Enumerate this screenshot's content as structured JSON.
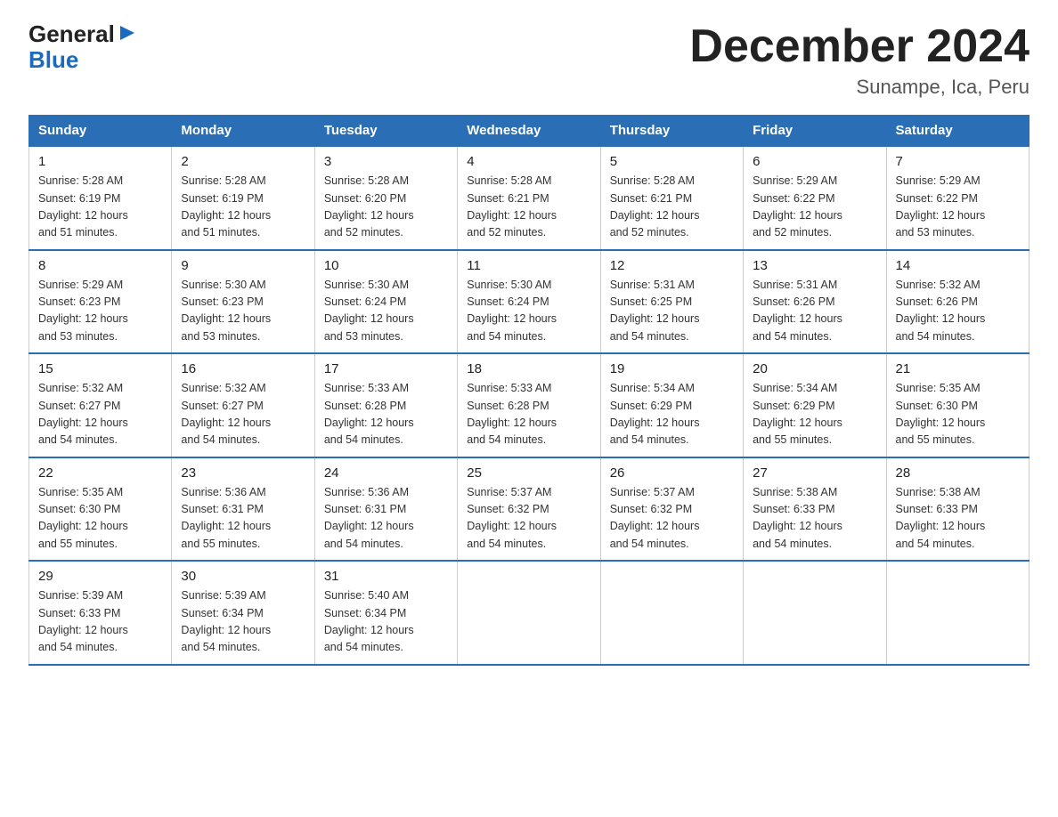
{
  "logo": {
    "general": "General",
    "blue": "Blue"
  },
  "title": "December 2024",
  "location": "Sunampe, Ica, Peru",
  "days_of_week": [
    "Sunday",
    "Monday",
    "Tuesday",
    "Wednesday",
    "Thursday",
    "Friday",
    "Saturday"
  ],
  "weeks": [
    [
      {
        "day": "1",
        "sunrise": "5:28 AM",
        "sunset": "6:19 PM",
        "daylight": "12 hours and 51 minutes."
      },
      {
        "day": "2",
        "sunrise": "5:28 AM",
        "sunset": "6:19 PM",
        "daylight": "12 hours and 51 minutes."
      },
      {
        "day": "3",
        "sunrise": "5:28 AM",
        "sunset": "6:20 PM",
        "daylight": "12 hours and 52 minutes."
      },
      {
        "day": "4",
        "sunrise": "5:28 AM",
        "sunset": "6:21 PM",
        "daylight": "12 hours and 52 minutes."
      },
      {
        "day": "5",
        "sunrise": "5:28 AM",
        "sunset": "6:21 PM",
        "daylight": "12 hours and 52 minutes."
      },
      {
        "day": "6",
        "sunrise": "5:29 AM",
        "sunset": "6:22 PM",
        "daylight": "12 hours and 52 minutes."
      },
      {
        "day": "7",
        "sunrise": "5:29 AM",
        "sunset": "6:22 PM",
        "daylight": "12 hours and 53 minutes."
      }
    ],
    [
      {
        "day": "8",
        "sunrise": "5:29 AM",
        "sunset": "6:23 PM",
        "daylight": "12 hours and 53 minutes."
      },
      {
        "day": "9",
        "sunrise": "5:30 AM",
        "sunset": "6:23 PM",
        "daylight": "12 hours and 53 minutes."
      },
      {
        "day": "10",
        "sunrise": "5:30 AM",
        "sunset": "6:24 PM",
        "daylight": "12 hours and 53 minutes."
      },
      {
        "day": "11",
        "sunrise": "5:30 AM",
        "sunset": "6:24 PM",
        "daylight": "12 hours and 54 minutes."
      },
      {
        "day": "12",
        "sunrise": "5:31 AM",
        "sunset": "6:25 PM",
        "daylight": "12 hours and 54 minutes."
      },
      {
        "day": "13",
        "sunrise": "5:31 AM",
        "sunset": "6:26 PM",
        "daylight": "12 hours and 54 minutes."
      },
      {
        "day": "14",
        "sunrise": "5:32 AM",
        "sunset": "6:26 PM",
        "daylight": "12 hours and 54 minutes."
      }
    ],
    [
      {
        "day": "15",
        "sunrise": "5:32 AM",
        "sunset": "6:27 PM",
        "daylight": "12 hours and 54 minutes."
      },
      {
        "day": "16",
        "sunrise": "5:32 AM",
        "sunset": "6:27 PM",
        "daylight": "12 hours and 54 minutes."
      },
      {
        "day": "17",
        "sunrise": "5:33 AM",
        "sunset": "6:28 PM",
        "daylight": "12 hours and 54 minutes."
      },
      {
        "day": "18",
        "sunrise": "5:33 AM",
        "sunset": "6:28 PM",
        "daylight": "12 hours and 54 minutes."
      },
      {
        "day": "19",
        "sunrise": "5:34 AM",
        "sunset": "6:29 PM",
        "daylight": "12 hours and 54 minutes."
      },
      {
        "day": "20",
        "sunrise": "5:34 AM",
        "sunset": "6:29 PM",
        "daylight": "12 hours and 55 minutes."
      },
      {
        "day": "21",
        "sunrise": "5:35 AM",
        "sunset": "6:30 PM",
        "daylight": "12 hours and 55 minutes."
      }
    ],
    [
      {
        "day": "22",
        "sunrise": "5:35 AM",
        "sunset": "6:30 PM",
        "daylight": "12 hours and 55 minutes."
      },
      {
        "day": "23",
        "sunrise": "5:36 AM",
        "sunset": "6:31 PM",
        "daylight": "12 hours and 55 minutes."
      },
      {
        "day": "24",
        "sunrise": "5:36 AM",
        "sunset": "6:31 PM",
        "daylight": "12 hours and 54 minutes."
      },
      {
        "day": "25",
        "sunrise": "5:37 AM",
        "sunset": "6:32 PM",
        "daylight": "12 hours and 54 minutes."
      },
      {
        "day": "26",
        "sunrise": "5:37 AM",
        "sunset": "6:32 PM",
        "daylight": "12 hours and 54 minutes."
      },
      {
        "day": "27",
        "sunrise": "5:38 AM",
        "sunset": "6:33 PM",
        "daylight": "12 hours and 54 minutes."
      },
      {
        "day": "28",
        "sunrise": "5:38 AM",
        "sunset": "6:33 PM",
        "daylight": "12 hours and 54 minutes."
      }
    ],
    [
      {
        "day": "29",
        "sunrise": "5:39 AM",
        "sunset": "6:33 PM",
        "daylight": "12 hours and 54 minutes."
      },
      {
        "day": "30",
        "sunrise": "5:39 AM",
        "sunset": "6:34 PM",
        "daylight": "12 hours and 54 minutes."
      },
      {
        "day": "31",
        "sunrise": "5:40 AM",
        "sunset": "6:34 PM",
        "daylight": "12 hours and 54 minutes."
      },
      null,
      null,
      null,
      null
    ]
  ],
  "labels": {
    "sunrise": "Sunrise:",
    "sunset": "Sunset:",
    "daylight": "Daylight:"
  }
}
